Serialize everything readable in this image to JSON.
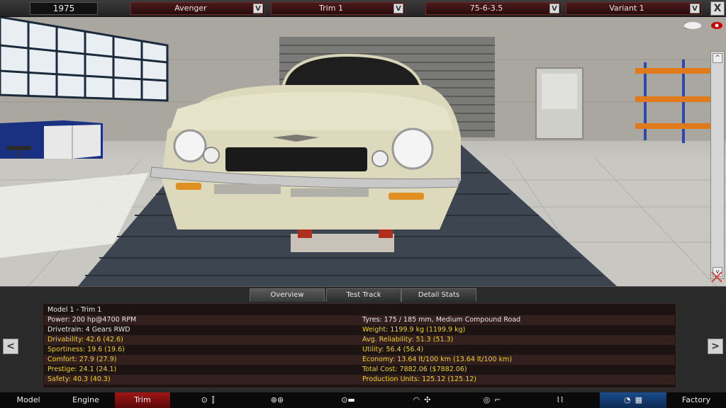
{
  "topbar": {
    "year": "1975",
    "model_select": "Avenger",
    "trim_select": "Trim 1",
    "engine_select": "75-6-3.5",
    "variant_select": "Variant 1",
    "dropdown_glyph": "V",
    "close_glyph": "X"
  },
  "camera_strip": {
    "up_arrow": "^",
    "down_arrow": "v"
  },
  "tabs": {
    "overview": "Overview",
    "test_track": "Test Track",
    "detail_stats": "Detail Stats"
  },
  "stats": {
    "title": "Model 1 - Trim 1",
    "left": [
      {
        "text": "Power: 200 hp@4700 RPM",
        "color": "white"
      },
      {
        "text": "Drivetrain: 4 Gears RWD",
        "color": "white"
      },
      {
        "text": "Drivability: 42.6 (42.6)",
        "color": "yellow"
      },
      {
        "text": "Sportiness: 19.6 (19.6)",
        "color": "yellow"
      },
      {
        "text": "Comfort: 27.9 (27.9)",
        "color": "yellow"
      },
      {
        "text": "Prestige: 24.1 (24.1)",
        "color": "yellow"
      },
      {
        "text": "Safety: 40.3 (40.3)",
        "color": "yellow"
      }
    ],
    "right": [
      {
        "text": "Tyres: 175 / 185 mm, Medium Compound Road",
        "color": "white"
      },
      {
        "text": "Weight: 1199.9 kg (1199.9 kg)",
        "color": "yellow"
      },
      {
        "text": "Avg. Reliability: 51.3 (51.3)",
        "color": "yellow"
      },
      {
        "text": "Utility: 56.4 (56.4)",
        "color": "yellow"
      },
      {
        "text": "Economy: 13.64 lt/100 km (13.64 lt/100 km)",
        "color": "yellow"
      },
      {
        "text": "Total Cost: 7882.06 ($7882.06)",
        "color": "yellow"
      },
      {
        "text": "Production Units: 125.12 (125.12)",
        "color": "yellow"
      }
    ],
    "prev_glyph": "<",
    "next_glyph": ">"
  },
  "bottom_nav": {
    "model": "Model",
    "engine": "Engine",
    "trim": "Trim",
    "factory": "Factory"
  },
  "colors": {
    "accent_red": "#a01616",
    "stat_yellow": "#f0d02a",
    "nav_blue": "#1a4c8c"
  },
  "icons": [
    "camera-icon",
    "eye-icon",
    "car-side-icon",
    "wheel-icon",
    "gearbox-icon",
    "chassis-icon",
    "fan-icon",
    "steering-wheel-icon",
    "seat-icon",
    "suspension-icon",
    "gauge-icon",
    "checkered-flag-icon"
  ]
}
